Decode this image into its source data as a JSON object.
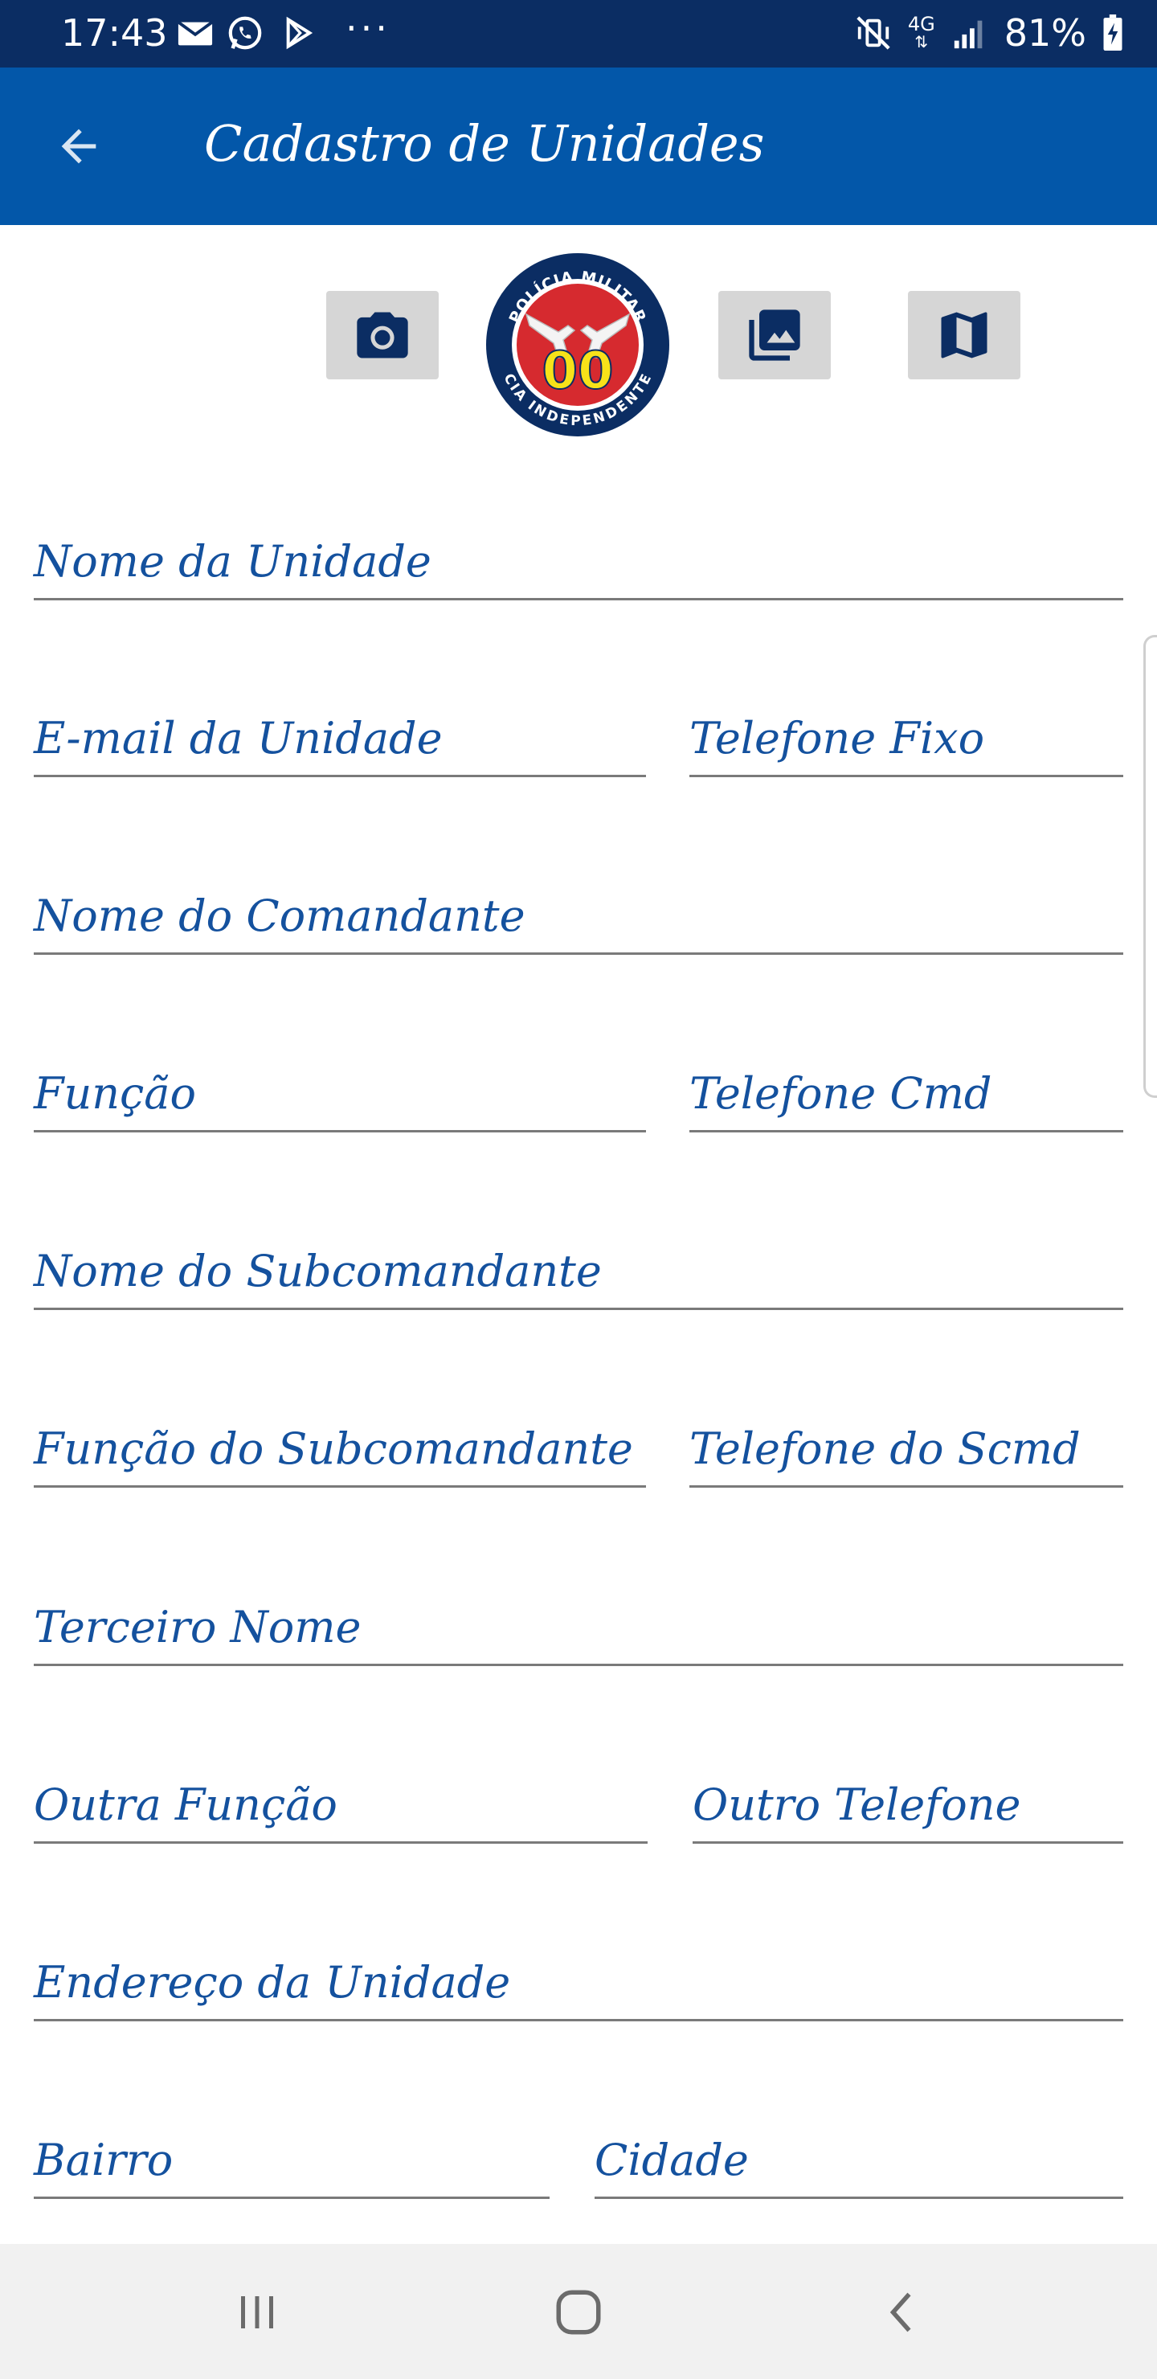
{
  "status_bar": {
    "time": "17:43",
    "network": "4G",
    "battery": "81%",
    "overflow": "···"
  },
  "app_bar": {
    "title": "Cadastro de Unidades",
    "back_icon": "arrow-back-icon"
  },
  "toolbar": {
    "camera_icon": "camera-icon",
    "gallery_icon": "photo-library-icon",
    "map_icon": "map-icon"
  },
  "badge": {
    "top_text": "POLÍCIA MILITAR",
    "number": "00",
    "bottom_text": "CIA INDEPENDENTE"
  },
  "form": {
    "nome_unidade": "Nome da Unidade",
    "email_unidade": "E-mail da Unidade",
    "telefone_fixo": "Telefone Fixo",
    "nome_comandante": "Nome do Comandante",
    "funcao": "Função",
    "telefone_cmd": "Telefone Cmd",
    "nome_subcomandante": "Nome do Subcomandante",
    "funcao_subcomandante": "Função do Subcomandante",
    "telefone_scmd": "Telefone do Scmd",
    "terceiro_nome": "Terceiro Nome",
    "outra_funcao": "Outra Função",
    "outro_telefone": "Outro Telefone",
    "endereco_unidade": "Endereço da Unidade",
    "bairro": "Bairro",
    "cidade": "Cidade"
  },
  "colors": {
    "status_bar": "#0b2d63",
    "app_bar": "#0357a9",
    "label": "#14519e",
    "badge_red": "#d62a2f",
    "badge_yellow": "#f7e219",
    "badge_navy": "#0b2d63"
  },
  "nav_bar": {
    "recents_icon": "recents-icon",
    "home_icon": "home-icon",
    "back_icon": "nav-back-icon"
  }
}
